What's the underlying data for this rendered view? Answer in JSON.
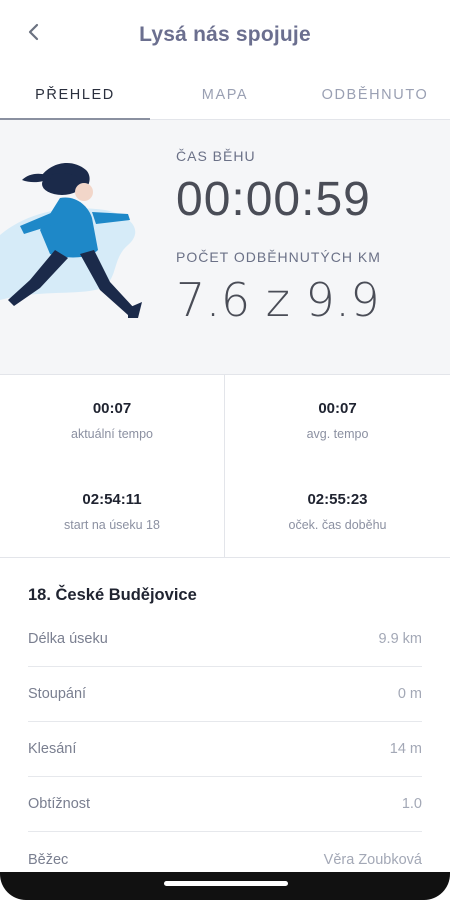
{
  "header": {
    "title": "Lysá nás spojuje",
    "back_icon": "chevron-left-icon"
  },
  "tabs": [
    {
      "label": "PŘEHLED",
      "active": true
    },
    {
      "label": "MAPA",
      "active": false
    },
    {
      "label": "ODBĚHNUTO",
      "active": false
    }
  ],
  "hero": {
    "time_label": "ČAS BĚHU",
    "time_value": "00:00:59",
    "km_label": "POČET ODBĚHNUTÝCH KM",
    "km_value": "7.6 z 9.9"
  },
  "stats": {
    "current_pace": {
      "value": "00:07",
      "label": "aktuální tempo"
    },
    "avg_pace": {
      "value": "00:07",
      "label": "avg. tempo"
    },
    "start": {
      "value": "02:54:11",
      "label": "start na úseku 18"
    },
    "expected_finish": {
      "value": "02:55:23",
      "label": "oček. čas doběhu"
    }
  },
  "segment": {
    "title": "18. České Budějovice",
    "rows": [
      {
        "label": "Délka úseku",
        "value": "9.9 km"
      },
      {
        "label": "Stoupání",
        "value": "0 m"
      },
      {
        "label": "Klesání",
        "value": "14 m"
      },
      {
        "label": "Obtížnost",
        "value": "1.0"
      },
      {
        "label": "Běžec",
        "value": "Věra Zoubková"
      }
    ]
  },
  "colors": {
    "accent": "#1e88c8",
    "runner_dark": "#1b2a4a",
    "hero_bg": "#f5f6f8"
  }
}
